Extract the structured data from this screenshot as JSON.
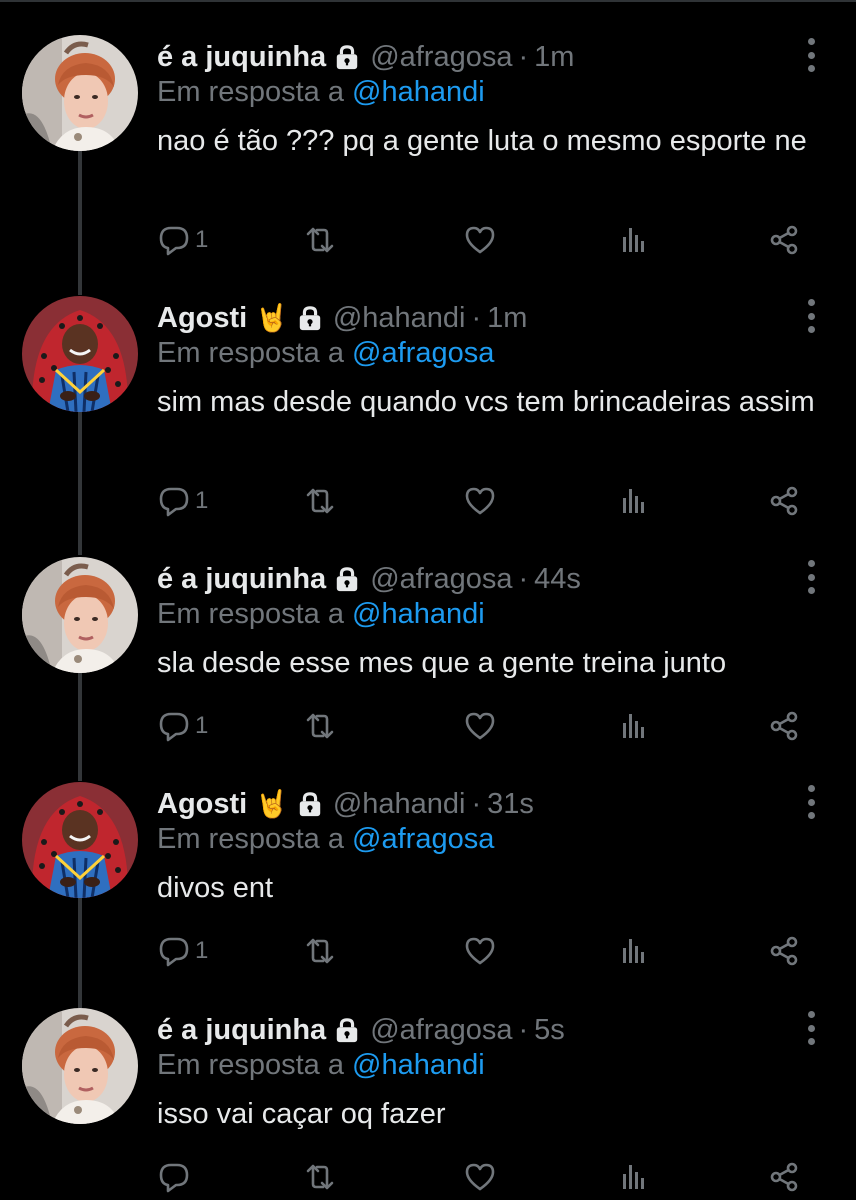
{
  "tweets": [
    {
      "author": "é a juquinha",
      "emoji": "",
      "handle": "@afragosa",
      "time": "1m",
      "reply_label": "Em resposta a",
      "reply_to": "@hahandi",
      "text": "nao é tão ??? pq a gente luta o mesmo esporte ne",
      "reply_count": "1",
      "avatar": "redhead-avatar"
    },
    {
      "author": "Agosti",
      "emoji": "🤘",
      "handle": "@hahandi",
      "time": "1m",
      "reply_label": "Em resposta a",
      "reply_to": "@afragosa",
      "text": "sim mas desde quando vcs tem brincadeiras assim",
      "reply_count": "1",
      "avatar": "red-hood-avatar"
    },
    {
      "author": "é a juquinha",
      "emoji": "",
      "handle": "@afragosa",
      "time": "44s",
      "reply_label": "Em resposta a",
      "reply_to": "@hahandi",
      "text": "sla desde esse mes que a gente treina junto",
      "reply_count": "1",
      "avatar": "redhead-avatar"
    },
    {
      "author": "Agosti",
      "emoji": "🤘",
      "handle": "@hahandi",
      "time": "31s",
      "reply_label": "Em resposta a",
      "reply_to": "@afragosa",
      "text": "divos ent",
      "reply_count": "1",
      "avatar": "red-hood-avatar"
    },
    {
      "author": "é a juquinha",
      "emoji": "",
      "handle": "@afragosa",
      "time": "5s",
      "reply_label": "Em resposta a",
      "reply_to": "@hahandi",
      "text": "isso vai caçar oq fazer",
      "reply_count": "",
      "avatar": "redhead-avatar"
    }
  ],
  "separator": "·",
  "icons": {
    "lock": "lock-icon",
    "reply": "reply-icon",
    "retweet": "retweet-icon",
    "like": "heart-icon",
    "views": "views-icon",
    "share": "share-icon",
    "more": "more-icon"
  },
  "colors": {
    "background": "#000000",
    "text": "#e7e9ea",
    "muted": "#71767b",
    "link": "#1d9bf0",
    "thread_line": "#333639"
  }
}
